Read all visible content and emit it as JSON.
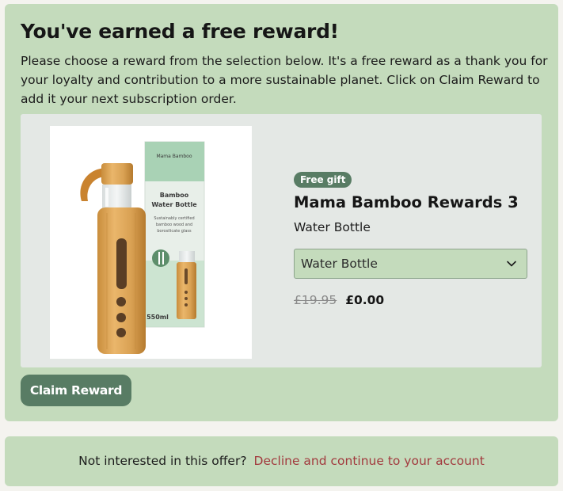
{
  "reward": {
    "title": "You've earned a free reward!",
    "intro": "Please choose a reward from the selection below. It's a free reward as a thank you for your loyalty and contribution to a more sustainable planet. Click on Claim Reward to add it your next subscription order.",
    "product": {
      "badge": "Free gift",
      "name": "Mama Bamboo Rewards 3",
      "subtitle": "Water Bottle",
      "selected_variant": "Water Bottle",
      "original_price": "£19.95",
      "price": "£0.00",
      "image": {
        "box_brand": "Mama Bamboo",
        "box_title": "Bamboo Water Bottle",
        "box_text": "Sustainably certified bamboo wood and borosilicate glass",
        "box_volume": "550ml"
      }
    },
    "claim_label": "Claim Reward"
  },
  "decline": {
    "question": "Not interested in this offer?",
    "link": "Decline and continue to your account"
  },
  "colors": {
    "card_background": "#c4dbbc",
    "panel_background": "#e4e8e5",
    "accent": "#587c64",
    "link": "#a23a3e"
  },
  "icons": {
    "select_chevron": "chevron-down-icon"
  }
}
